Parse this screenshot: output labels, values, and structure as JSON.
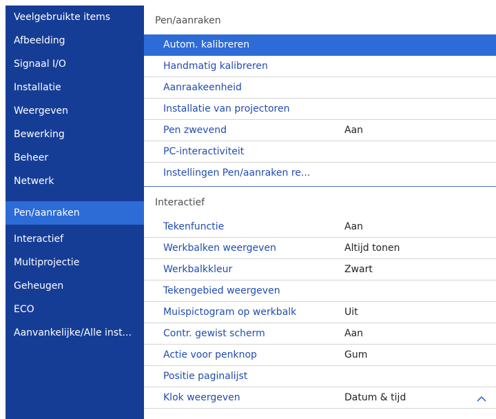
{
  "sidebar": {
    "items": [
      {
        "label": "Veelgebruikte items"
      },
      {
        "label": "Afbeelding"
      },
      {
        "label": "Signaal I/O"
      },
      {
        "label": "Installatie"
      },
      {
        "label": "Weergeven"
      },
      {
        "label": "Bewerking"
      },
      {
        "label": "Beheer"
      },
      {
        "label": "Netwerk"
      },
      {
        "label": "Pen/aanraken"
      },
      {
        "label": "Interactief"
      },
      {
        "label": "Multiprojectie"
      },
      {
        "label": "Geheugen"
      },
      {
        "label": "ECO"
      },
      {
        "label": "Aanvankelijke/Alle inst..."
      }
    ],
    "selected": "Pen/aanraken"
  },
  "main": {
    "sections": [
      {
        "title": "Pen/aanraken",
        "rows": [
          {
            "label": "Autom. kalibreren",
            "value": ""
          },
          {
            "label": "Handmatig kalibreren",
            "value": ""
          },
          {
            "label": "Aanraakeenheid",
            "value": ""
          },
          {
            "label": "Installatie van projectoren",
            "value": ""
          },
          {
            "label": "Pen zwevend",
            "value": "Aan"
          },
          {
            "label": "PC-interactiviteit",
            "value": ""
          },
          {
            "label": "Instellingen Pen/aanraken re...",
            "value": ""
          }
        ]
      },
      {
        "title": "Interactief",
        "rows": [
          {
            "label": "Tekenfunctie",
            "value": "Aan"
          },
          {
            "label": "Werkbalken weergeven",
            "value": "Altijd tonen"
          },
          {
            "label": "Werkbalkkleur",
            "value": "Zwart"
          },
          {
            "label": "Tekengebied weergeven",
            "value": ""
          },
          {
            "label": "Muispictogram op werkbalk",
            "value": "Uit"
          },
          {
            "label": "Contr. gewist scherm",
            "value": "Aan"
          },
          {
            "label": "Actie voor penknop",
            "value": "Gum"
          },
          {
            "label": "Positie paginalijst",
            "value": ""
          },
          {
            "label": "Klok weergeven",
            "value": "Datum & tijd"
          }
        ]
      }
    ],
    "selected_row": "Autom. kalibreren"
  },
  "icons": {
    "scroll": "chevron-up-icon"
  },
  "colors": {
    "sidebar_bg": "#163d96",
    "highlight": "#2d6cd6",
    "item_text": "#1f4cb0"
  }
}
